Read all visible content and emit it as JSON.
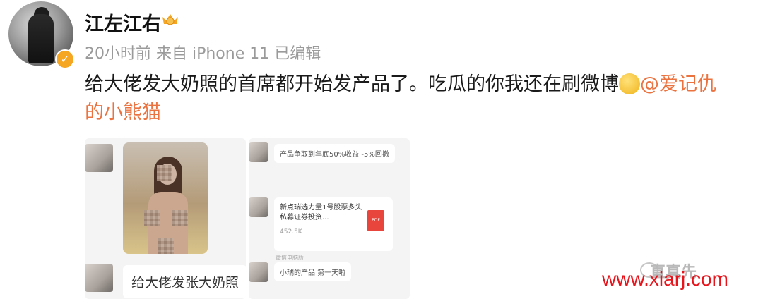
{
  "user": {
    "name": "江左江右",
    "meta": "20小时前 来自 iPhone 11 已编辑"
  },
  "post": {
    "text": "给大佬发大奶照的首席都开始发产品了。吃瓜的你我还在刷微博",
    "mention": "@爱记仇的小熊猫"
  },
  "images": [
    {
      "bubble_text": "给大佬发张大奶照"
    },
    {
      "msg1": "产品争取到年底50%收益 -5%回撤",
      "file_title": "新点瑞选力量1号股票多头私募证券投资...",
      "file_size": "452.5K",
      "file_source": "微信电脑版",
      "msg2": "小瑞的产品 第一天啦"
    }
  ],
  "watermarks": {
    "account": "直真先",
    "site": "www.xiarj.com"
  },
  "colors": {
    "mention": "#eb7340",
    "verified": "#f5a623",
    "site_watermark": "#e8141c"
  }
}
